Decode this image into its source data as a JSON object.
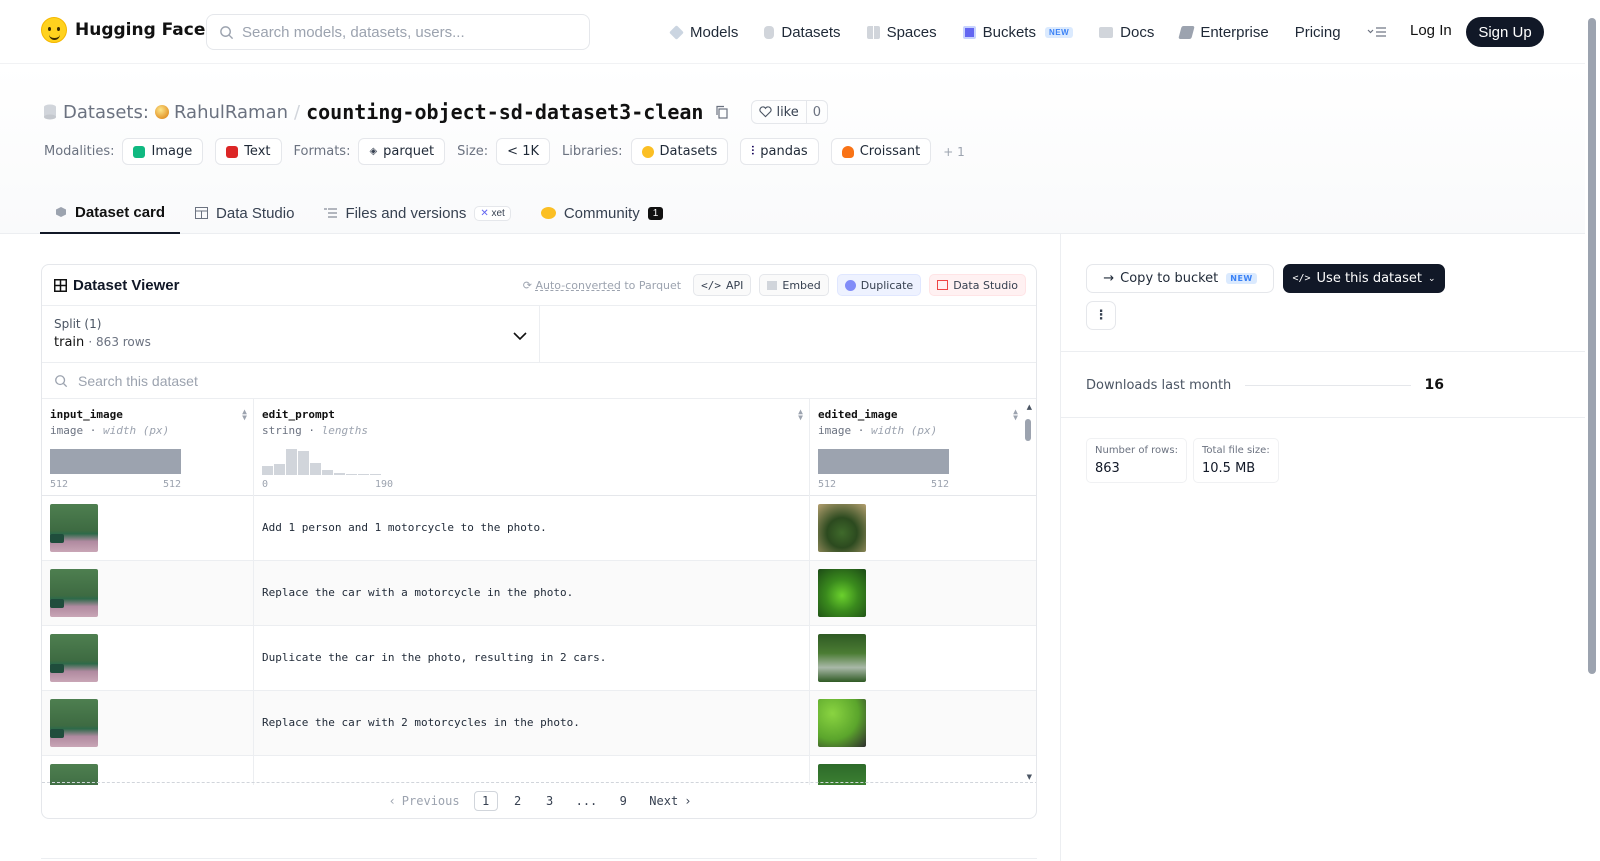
{
  "header": {
    "brand": "Hugging Face",
    "search_placeholder": "Search models, datasets, users...",
    "nav": [
      {
        "label": "Models"
      },
      {
        "label": "Datasets"
      },
      {
        "label": "Spaces"
      },
      {
        "label": "Buckets",
        "badge": "NEW"
      },
      {
        "label": "Docs"
      },
      {
        "label": "Enterprise"
      },
      {
        "label": "Pricing"
      }
    ],
    "login": "Log In",
    "signup": "Sign Up"
  },
  "repo": {
    "section": "Datasets:",
    "owner": "RahulRaman",
    "separator": "/",
    "name": "counting-object-sd-dataset3-clean",
    "like_label": "like",
    "like_count": "0"
  },
  "tags": {
    "modalities_label": "Modalities:",
    "modalities": [
      "Image",
      "Text"
    ],
    "formats_label": "Formats:",
    "formats": [
      "parquet"
    ],
    "size_label": "Size:",
    "size": "< 1K",
    "libraries_label": "Libraries:",
    "libraries": [
      "Datasets",
      "pandas",
      "Croissant"
    ],
    "more": "+ 1"
  },
  "tabs": {
    "card": "Dataset card",
    "studio": "Data Studio",
    "files": "Files and versions",
    "files_badge": "xet",
    "community": "Community",
    "community_count": "1"
  },
  "viewer": {
    "title": "Dataset Viewer",
    "auto_converted": "Auto-converted",
    "to_parquet": " to Parquet",
    "api": "API",
    "embed": "Embed",
    "duplicate": "Duplicate",
    "data_studio": "Data Studio",
    "split_label": "Split (1)",
    "split_value": "train",
    "split_rows": "863 rows",
    "search_placeholder": "Search this dataset",
    "columns": [
      {
        "name": "input_image",
        "type": "image",
        "stat": "width (px)",
        "min": "512",
        "max": "512"
      },
      {
        "name": "edit_prompt",
        "type": "string",
        "stat": "lengths",
        "min": "0",
        "max": "190"
      },
      {
        "name": "edited_image",
        "type": "image",
        "stat": "width (px)",
        "min": "512",
        "max": "512"
      }
    ],
    "rows": [
      {
        "prompt": "Add 1 person and 1 motorcycle to the photo."
      },
      {
        "prompt": "Replace the car with a motorcycle in the photo."
      },
      {
        "prompt": "Duplicate the car in the photo, resulting in 2 cars."
      },
      {
        "prompt": "Replace the car with 2 motorcycles in the photo."
      },
      {
        "prompt": ""
      }
    ],
    "pager": {
      "prev": "Previous",
      "pages": [
        "1",
        "2",
        "3",
        "...",
        "9"
      ],
      "next": "Next",
      "current": "1"
    }
  },
  "sidebar": {
    "copy_bucket": "Copy to bucket",
    "copy_badge": "NEW",
    "use_dataset": "Use this dataset",
    "downloads_label": "Downloads last month",
    "downloads_value": "16",
    "rows_label": "Number of rows:",
    "rows_value": "863",
    "size_label": "Total file size:",
    "size_value": "10.5 MB"
  }
}
